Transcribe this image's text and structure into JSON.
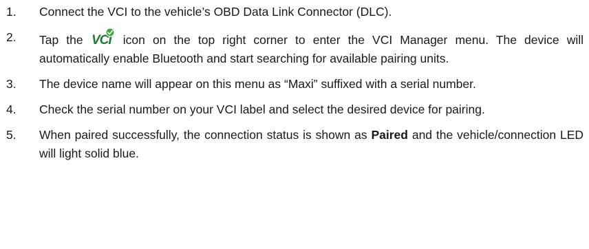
{
  "steps": [
    {
      "number": "1.",
      "text": "Connect the VCI to the vehicle’s OBD Data Link Connector (DLC)."
    },
    {
      "number": "2.",
      "text_before": "Tap the",
      "icon": "vci-icon",
      "icon_label": "VCI",
      "text_after": " icon on the top right corner to enter the VCI Manager menu. The device will automatically enable Bluetooth and start searching for available pairing units."
    },
    {
      "number": "3.",
      "text": "The device name will appear on this menu as “Maxi” suffixed with a serial number."
    },
    {
      "number": "4.",
      "text": "Check the serial number on your VCI label and select the desired device for pairing."
    },
    {
      "number": "5.",
      "text_before": "When paired successfully, the connection status is shown as ",
      "bold": "Paired",
      "text_after": " and the vehicle/connection LED will light solid blue."
    }
  ],
  "colors": {
    "icon_text": "#1f7a34",
    "icon_check_bg": "#3aaa35",
    "body_text": "#1a1a1a"
  }
}
